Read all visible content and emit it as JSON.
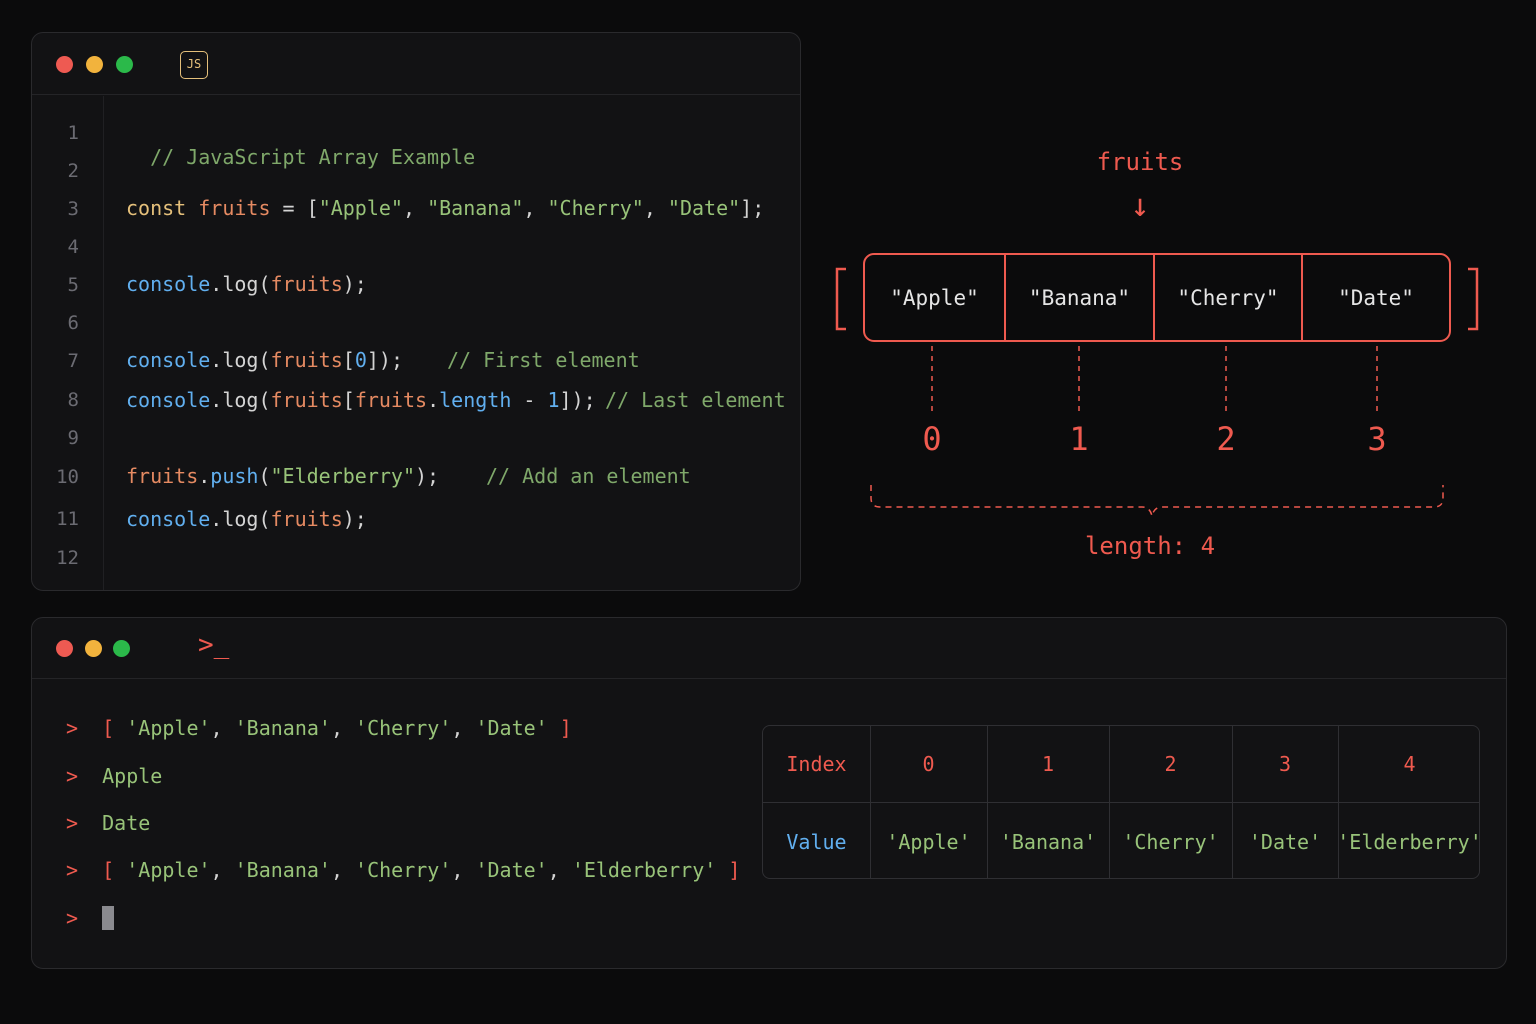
{
  "editor": {
    "badge": "JS",
    "line_numbers": [
      "1",
      "2",
      "3",
      "4",
      "5",
      "6",
      "7",
      "8",
      "9",
      "10",
      "11",
      "12"
    ],
    "lines": {
      "l1": {
        "comment": "// JavaScript Array Example"
      },
      "l3": {
        "kw": "const",
        "var": "fruits",
        "eq": " = [",
        "s1": "\"Apple\"",
        "c1": ", ",
        "s2": "\"Banana\"",
        "c2": ", ",
        "s3": "\"Cherry\"",
        "c3": ", ",
        "s4": "\"Date\"",
        "end": "];"
      },
      "l5": {
        "obj": "console",
        "dot": ".",
        "fn": "log",
        "open": "(",
        "arg": "fruits",
        "close": ");"
      },
      "l7": {
        "obj": "console",
        "dot": ".",
        "fn": "log",
        "open": "(",
        "arg": "fruits",
        "ob": "[",
        "idx": "0",
        "close": "]);",
        "comment": "// First element"
      },
      "l8": {
        "obj": "console",
        "dot": ".",
        "fn": "log",
        "open": "(",
        "arg": "fruits",
        "ob": "[",
        "arg2": "fruits",
        "dot2": ".",
        "prop": "length",
        "minus": " - ",
        "num": "1",
        "close": "]);",
        "comment": "// Last element"
      },
      "l10": {
        "var": "fruits",
        "dot": ".",
        "fn": "push",
        "open": "(",
        "str": "\"Elderberry\"",
        "close": ");",
        "comment": "// Add an element"
      },
      "l11": {
        "obj": "console",
        "dot": ".",
        "fn": "log",
        "open": "(",
        "arg": "fruits",
        "close": ");"
      }
    }
  },
  "diagram": {
    "label": "fruits",
    "arrow": "↓",
    "open_bracket": "[",
    "close_bracket": "]",
    "cells": [
      "\"Apple\"",
      "\"Banana\"",
      "\"Cherry\"",
      "\"Date\""
    ],
    "indices": [
      "0",
      "1",
      "2",
      "3"
    ],
    "length_label": "length: 4"
  },
  "terminal": {
    "icon": ">_",
    "prompt": ">",
    "out1": {
      "open": "[ ",
      "items": [
        "'Apple'",
        "'Banana'",
        "'Cherry'",
        "'Date'"
      ],
      "sep": ", ",
      "close": " ]"
    },
    "out2": "Apple",
    "out3": "Date",
    "out4": {
      "open": "[ ",
      "items": [
        "'Apple'",
        "'Banana'",
        "'Cherry'",
        "'Date'",
        "'Elderberry'"
      ],
      "sep": ", ",
      "close": " ]"
    }
  },
  "table": {
    "row_labels": [
      "Index",
      "Value"
    ],
    "indices": [
      "0",
      "1",
      "2",
      "3",
      "4"
    ],
    "values": [
      "'Apple'",
      "'Banana'",
      "'Cherry'",
      "'Date'",
      "'Elderberry'"
    ]
  },
  "colors": {
    "red_dot": "#ee5a52",
    "yellow_dot": "#f2b33d",
    "green_dot": "#2bb94a",
    "accent": "#ef5a4f"
  }
}
